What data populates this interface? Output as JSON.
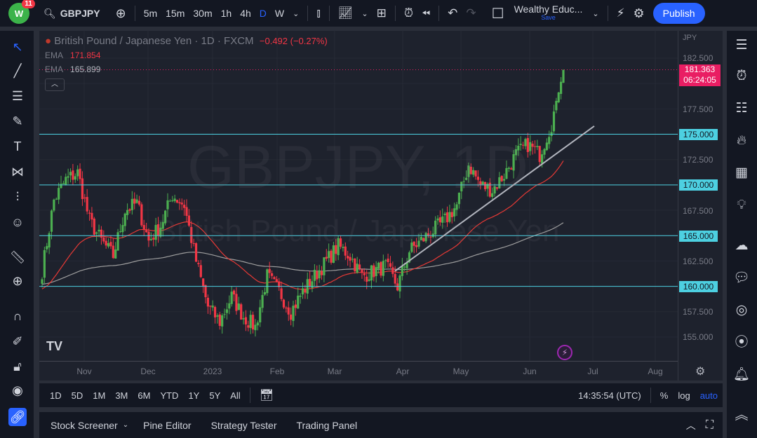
{
  "topbar": {
    "badge": "11",
    "symbol": "GBPJPY",
    "intervals": [
      "5m",
      "15m",
      "30m",
      "1h",
      "4h",
      "D",
      "W"
    ],
    "active_interval": "D",
    "layout_name": "Wealthy Educ...",
    "save": "Save",
    "publish": "Publish"
  },
  "legend": {
    "title": "British Pound / Japanese Yen · 1D · FXCM",
    "change": "−0.492 (−0.27%)",
    "ema1_label": "EMA",
    "ema1_value": "171.854",
    "ema2_label": "EMA",
    "ema2_value": "165.899"
  },
  "watermark": {
    "symbol": "GBPJPY, 1D",
    "name": "British Pound / Japanese Yen"
  },
  "price_axis": {
    "currency": "JPY",
    "ticks": [
      "182.500",
      "177.500",
      "172.500",
      "167.500",
      "162.500",
      "157.500",
      "155.000"
    ],
    "levels": [
      "175.000",
      "170.000",
      "165.000",
      "160.000"
    ],
    "last_price": "181.363",
    "countdown": "06:24:05"
  },
  "time_axis": {
    "labels": [
      "Nov",
      "Dec",
      "2023",
      "Feb",
      "Mar",
      "Apr",
      "May",
      "Jun",
      "Jul",
      "Aug"
    ]
  },
  "range_bar": {
    "ranges": [
      "1D",
      "5D",
      "1M",
      "3M",
      "6M",
      "YTD",
      "1Y",
      "5Y",
      "All"
    ],
    "clock": "14:35:54 (UTC)",
    "percent": "%",
    "log": "log",
    "auto": "auto"
  },
  "bottom_panel": {
    "tabs": [
      "Stock Screener",
      "Pine Editor",
      "Strategy Tester",
      "Trading Panel"
    ]
  },
  "colors": {
    "up": "#4caf50",
    "down": "#f23645",
    "level": "#4dd0e1",
    "ema_fast": "#e53935",
    "ema_slow": "#9e9e9e",
    "accent": "#2962ff"
  },
  "chart_data": {
    "type": "candlestick",
    "symbol": "GBPJPY",
    "timeframe": "1D",
    "ylim": [
      153.5,
      184.5
    ],
    "weekly_closes": [
      161.5,
      168.5,
      170.5,
      171.2,
      166.5,
      164.5,
      163.0,
      167.5,
      168.2,
      164.5,
      166.0,
      169.0,
      168.0,
      162.5,
      158.0,
      156.5,
      159.0,
      157.0,
      156.0,
      161.0,
      159.5,
      157.5,
      159.5,
      161.0,
      162.5,
      164.0,
      163.0,
      161.0,
      161.5,
      162.0,
      160.0,
      163.5,
      164.5,
      165.5,
      166.5,
      168.0,
      172.0,
      170.0,
      169.5,
      171.0,
      173.0,
      174.0,
      173.0,
      176.0,
      181.36
    ],
    "levels": [
      175,
      170,
      165,
      160
    ],
    "trendline": [
      {
        "date": "2023-03-24",
        "price": 161.5
      },
      {
        "date": "2023-07-01",
        "price": 175.8
      }
    ]
  }
}
